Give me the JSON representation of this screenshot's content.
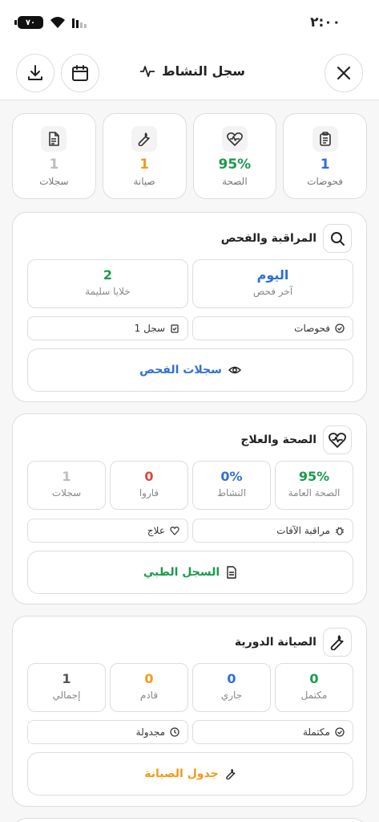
{
  "status_bar": {
    "time": "٢:٠٠",
    "battery": "٧٠"
  },
  "header": {
    "title": "سجل النشاط"
  },
  "stats": [
    {
      "value": "1",
      "label": "فحوصات",
      "color": "#2f6fd6",
      "icon": "clipboard-icon"
    },
    {
      "value": "95%",
      "label": "الصحة",
      "color": "#1a9b4b",
      "icon": "heart-pulse-icon"
    },
    {
      "value": "1",
      "label": "صيانة",
      "color": "#f29a1a",
      "icon": "wrench-icon"
    },
    {
      "value": "1",
      "label": "سجلات",
      "color": "#bdbdbd",
      "icon": "document-icon"
    }
  ],
  "monitoring": {
    "title": "المراقبة والفحص",
    "metrics": [
      {
        "value": "اليوم",
        "label": "آخر فحص"
      },
      {
        "value": "2",
        "label": "خلايا سليمة"
      }
    ],
    "chips": [
      "فحوصات",
      "1 سجل"
    ],
    "button": "سجلات الفحص"
  },
  "health": {
    "title": "الصحة والعلاج",
    "metrics": [
      {
        "value": "95%",
        "label": "الصحة العامة"
      },
      {
        "value": "0%",
        "label": "النشاط"
      },
      {
        "value": "0",
        "label": "فاروا"
      },
      {
        "value": "1",
        "label": "سجلات"
      }
    ],
    "chips": [
      "مراقبة الآفات",
      "علاج"
    ],
    "button": "السجل الطبي"
  },
  "maintenance": {
    "title": "الصيانة الدورية",
    "metrics": [
      {
        "value": "0",
        "label": "مكتمل"
      },
      {
        "value": "0",
        "label": "جاري"
      },
      {
        "value": "0",
        "label": "قادم"
      },
      {
        "value": "1",
        "label": "إجمالي"
      }
    ],
    "chips": [
      "مكتملة",
      "مجدولة"
    ],
    "button": "جدول الصيانة"
  }
}
